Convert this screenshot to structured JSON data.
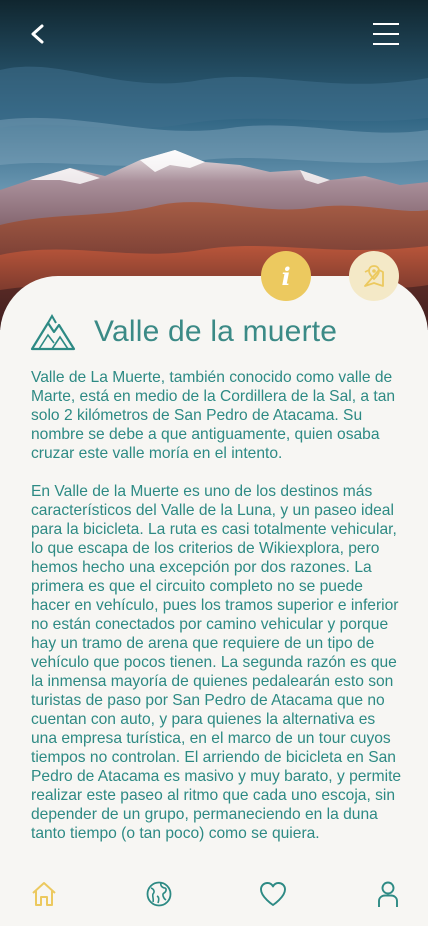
{
  "header": {
    "back_icon": "chevron-left-icon",
    "menu_icon": "hamburger-menu-icon"
  },
  "actions": {
    "info_label": "i",
    "map_icon": "map-pin-icon"
  },
  "place": {
    "icon": "mountain-icon",
    "title": "Valle de la muerte",
    "paragraphs": [
      "Valle de La Muerte, también conocido como valle de Marte, está en medio de la Cordillera de la Sal, a tan solo 2 kilómetros de San Pedro de Atacama. Su nombre se debe a que antiguamente, quien osaba cruzar este valle moría en el intento.",
      "En Valle de la Muerte es uno de los destinos más característicos del Valle de la Luna, y un paseo ideal para la bicicleta. La ruta es casi totalmente vehicular, lo que escapa de los criterios de Wikiexplora, pero hemos hecho una excepción por dos razones. La primera es que el circuito completo no se puede hacer en vehículo, pues los tramos superior e inferior no están conectados por camino vehicular y porque hay un tramo de arena que requiere de un tipo de vehículo que pocos tienen. La segunda razón es que la inmensa mayoría de quienes pedalearán esto son turistas de paso por San Pedro de Atacama que no cuentan con auto, y para quienes la alternativa es una empresa turística, en el marco de un tour cuyos tiempos no controlan. El arriendo de bicicleta en San Pedro de Atacama es masivo y muy barato, y permite realizar este paseo al ritmo que cada uno escoja, sin depender de un grupo, permaneciendo en la duna tanto tiempo (o tan poco) como se quiera."
    ]
  },
  "bottom_nav": {
    "items": [
      {
        "icon": "home-icon",
        "active": true
      },
      {
        "icon": "globe-icon",
        "active": false
      },
      {
        "icon": "heart-icon",
        "active": false
      },
      {
        "icon": "user-icon",
        "active": false
      }
    ]
  },
  "colors": {
    "accent_teal": "#2d8a84",
    "accent_yellow": "#ecc95f",
    "map_button_bg": "#f4e9c7",
    "background": "#f7f6f3"
  }
}
